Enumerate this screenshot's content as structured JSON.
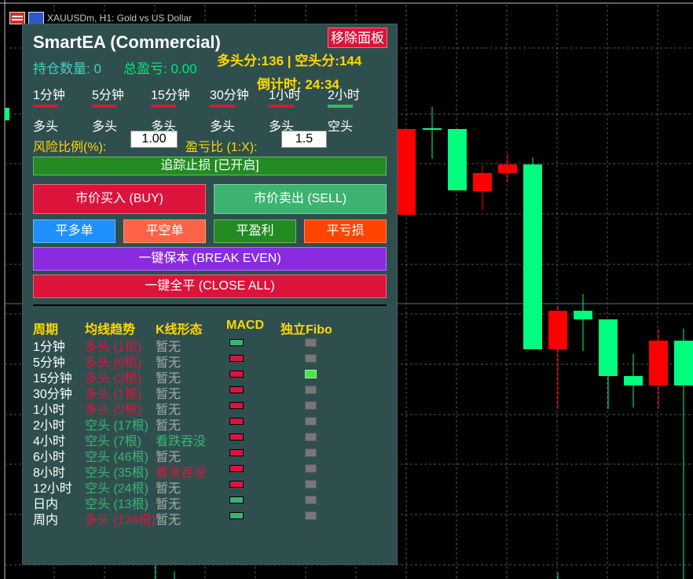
{
  "window": {
    "title": "XAUUSDm, H1:  Gold vs US Dollar"
  },
  "colors": {
    "bull": "#00ff7f",
    "bear": "#ff0000",
    "grid": "#555555",
    "panel_bg": "#2f4f4f",
    "macd_red": "#dc143c",
    "macd_green": "#3cb371"
  },
  "panel": {
    "title": "SmartEA (Commercial)",
    "remove_button": "移除面板",
    "score": "多头分:136 | 空头分:144",
    "countdown": "倒计时: 24:34",
    "position_count": "持仓数量: 0",
    "total_pnl": "总盈亏: 0.00",
    "timeframes": [
      {
        "label": "1分钟",
        "state": "多头",
        "bar_color": "#dc143c"
      },
      {
        "label": "5分钟",
        "state": "多头",
        "bar_color": "#dc143c"
      },
      {
        "label": "15分钟",
        "state": "多头",
        "bar_color": "#dc143c"
      },
      {
        "label": "30分钟",
        "state": "多头",
        "bar_color": "#dc143c"
      },
      {
        "label": "1小时",
        "state": "多头",
        "bar_color": "#dc143c"
      },
      {
        "label": "2小时",
        "state": "空头",
        "bar_color": "#3cb371"
      }
    ],
    "risk_label": "风险比例(%):",
    "risk_value": "1.00",
    "rr_label": "盈亏比 (1:X):",
    "rr_value": "1.5",
    "trailing_button": "追踪止损 [已开启]",
    "buy_button": "市价买入 (BUY)",
    "sell_button": "市价卖出 (SELL)",
    "close_long_button": "平多单",
    "close_short_button": "平空单",
    "close_profit_button": "平盈利",
    "close_loss_button": "平亏损",
    "breakeven_button": "一键保本 (BREAK EVEN)",
    "close_all_button": "一键全平 (CLOSE ALL)",
    "table": {
      "headers": [
        "周期",
        "均线趋势",
        "K线形态",
        "MACD",
        "独立Fibo"
      ],
      "rows": [
        {
          "period": "1分钟",
          "trend": "多头 (1根)",
          "trend_dir": "bull",
          "pattern": "暂无",
          "pattern_dir": "none",
          "macd": "green",
          "fibo": "off"
        },
        {
          "period": "5分钟",
          "trend": "多头 (8根)",
          "trend_dir": "bull",
          "pattern": "暂无",
          "pattern_dir": "none",
          "macd": "red",
          "fibo": "off"
        },
        {
          "period": "15分钟",
          "trend": "多头 (3根)",
          "trend_dir": "bull",
          "pattern": "暂无",
          "pattern_dir": "none",
          "macd": "red",
          "fibo": "on"
        },
        {
          "period": "30分钟",
          "trend": "多头 (1根)",
          "trend_dir": "bull",
          "pattern": "暂无",
          "pattern_dir": "none",
          "macd": "red",
          "fibo": "off"
        },
        {
          "period": "1小时",
          "trend": "多头 (2根)",
          "trend_dir": "bull",
          "pattern": "暂无",
          "pattern_dir": "none",
          "macd": "red",
          "fibo": "off"
        },
        {
          "period": "2小时",
          "trend": "空头 (17根)",
          "trend_dir": "bear",
          "pattern": "暂无",
          "pattern_dir": "none",
          "macd": "red",
          "fibo": "off"
        },
        {
          "period": "4小时",
          "trend": "空头 (7根)",
          "trend_dir": "bear",
          "pattern": "看跌吞没",
          "pattern_dir": "bear",
          "macd": "red",
          "fibo": "off"
        },
        {
          "period": "6小时",
          "trend": "空头 (46根)",
          "trend_dir": "bear",
          "pattern": "暂无",
          "pattern_dir": "none",
          "macd": "red",
          "fibo": "off"
        },
        {
          "period": "8小时",
          "trend": "空头 (35根)",
          "trend_dir": "bear",
          "pattern": "看涨吞没",
          "pattern_dir": "bull",
          "macd": "red",
          "fibo": "off"
        },
        {
          "period": "12小时",
          "trend": "空头 (24根)",
          "trend_dir": "bear",
          "pattern": "暂无",
          "pattern_dir": "none",
          "macd": "red",
          "fibo": "off"
        },
        {
          "period": "日内",
          "trend": "空头 (13根)",
          "trend_dir": "bear",
          "pattern": "暂无",
          "pattern_dir": "none",
          "macd": "green",
          "fibo": "off"
        },
        {
          "period": "周内",
          "trend": "多头 (126根)",
          "trend_dir": "bull",
          "pattern": "暂无",
          "pattern_dir": "none",
          "macd": "green",
          "fibo": "off"
        }
      ]
    }
  }
}
